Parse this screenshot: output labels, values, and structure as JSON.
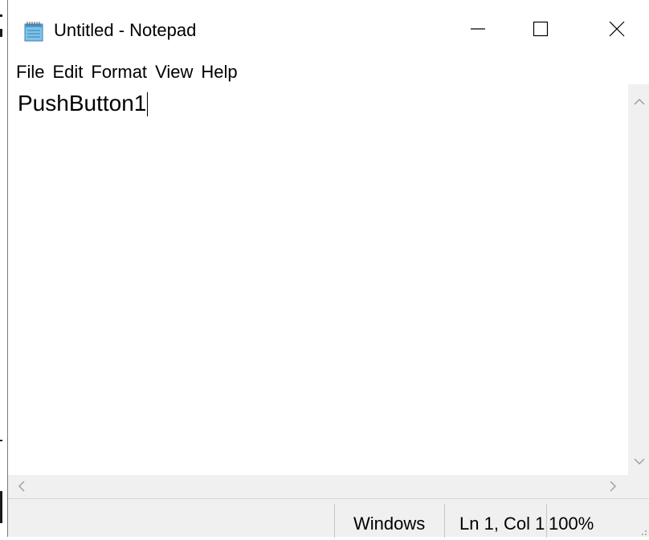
{
  "window": {
    "title": "Untitled - Notepad"
  },
  "menu": {
    "items": [
      "File",
      "Edit",
      "Format",
      "View",
      "Help"
    ]
  },
  "editor": {
    "content": "PushButton1"
  },
  "status": {
    "line_ending": "Windows",
    "position": "Ln 1, Col 1",
    "zoom": "100%"
  },
  "icons": {
    "app": "notepad-icon",
    "minimize": "minimize-icon",
    "maximize": "maximize-icon",
    "close": "close-icon",
    "scroll_up": "chevron-up-icon",
    "scroll_down": "chevron-down-icon",
    "scroll_left": "chevron-left-icon",
    "scroll_right": "chevron-right-icon",
    "resize_grip": "resize-grip-icon"
  },
  "colors": {
    "background": "#ffffff",
    "chrome": "#f0f0f0",
    "text": "#000000"
  }
}
